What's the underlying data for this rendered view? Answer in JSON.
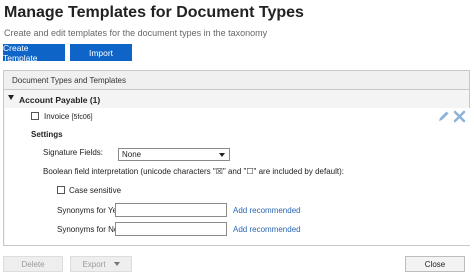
{
  "header": {
    "title": "Manage Templates for Document Types",
    "subtitle": "Create and edit templates for the document types in the taxonomy"
  },
  "toolbar": {
    "create_label": "Create Template",
    "import_label": "Import"
  },
  "panel": {
    "header_label": "Document Types and Templates",
    "group_label": "Account Payable (1)",
    "template": {
      "name": "Invoice",
      "code": "[5fc06]"
    },
    "settings_label": "Settings",
    "signature_label": "Signature Fields:",
    "signature_value": "None",
    "boolean_label": "Boolean field interpretation (unicode characters \"☒\" and \"☐\" are included by default):",
    "case_sensitive_label": "Case sensitive",
    "syn_yes_label": "Synonyms for Yes:",
    "syn_no_label": "Synonyms for No:",
    "add_recommended": "Add recommended",
    "syn_yes_value": "",
    "syn_no_value": ""
  },
  "footer": {
    "delete_label": "Delete",
    "export_label": "Export",
    "close_label": "Close"
  },
  "icons": {
    "edit": "pencil-icon",
    "delete": "close-icon",
    "dropdown": "caret-down-icon"
  },
  "colors": {
    "primary": "#0f64c8",
    "link": "#2a67b2",
    "icon": "#8db4d8"
  }
}
